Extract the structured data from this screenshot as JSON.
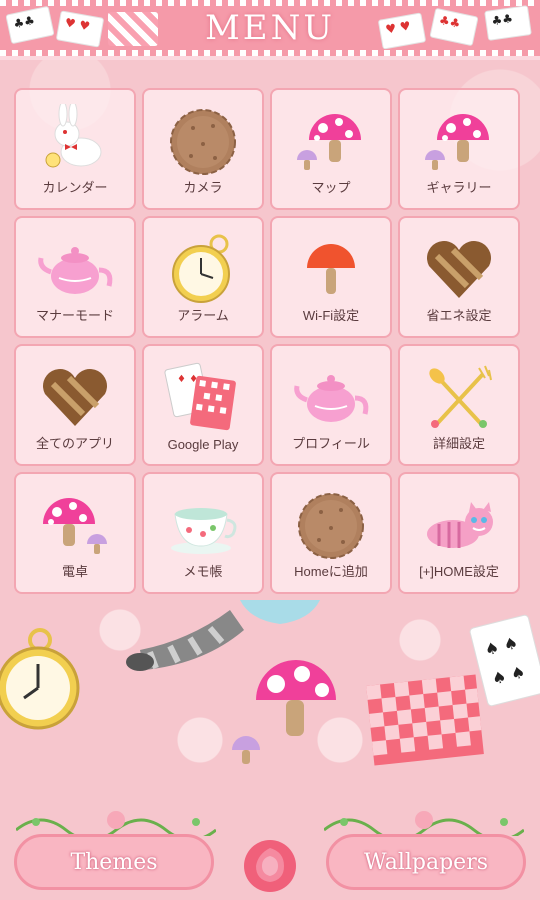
{
  "header": {
    "title": "MENU",
    "cards_left": [
      {
        "symbol": "♣♣",
        "suit": "black"
      },
      {
        "symbol": "♥ ♥",
        "suit": "red"
      }
    ],
    "cards_right": [
      {
        "symbol": "♥ ♥",
        "suit": "red"
      },
      {
        "symbol": "♣♣",
        "suit": "black"
      }
    ]
  },
  "apps": [
    {
      "label": "カレンダー",
      "icon": "white-rabbit-icon"
    },
    {
      "label": "カメラ",
      "icon": "cookie-icon"
    },
    {
      "label": "マップ",
      "icon": "mushroom-icon"
    },
    {
      "label": "ギャラリー",
      "icon": "mushroom-icon"
    },
    {
      "label": "マナーモード",
      "icon": "teapot-icon"
    },
    {
      "label": "アラーム",
      "icon": "pocket-watch-icon"
    },
    {
      "label": "Wi-Fi設定",
      "icon": "red-lollipop-icon"
    },
    {
      "label": "省エネ設定",
      "icon": "chocolate-heart-icon"
    },
    {
      "label": "全てのアプリ",
      "icon": "chocolate-heart-icon"
    },
    {
      "label": "Google Play",
      "icon": "playing-cards-icon"
    },
    {
      "label": "プロフィール",
      "icon": "teapot-icon"
    },
    {
      "label": "詳細設定",
      "icon": "spoon-fork-icon"
    },
    {
      "label": "電卓",
      "icon": "mushroom-icon"
    },
    {
      "label": "メモ帳",
      "icon": "teacup-icon"
    },
    {
      "label": "Homeに追加",
      "icon": "cookie-icon"
    },
    {
      "label": "[+]HOME設定",
      "icon": "cheshire-cat-icon"
    }
  ],
  "dock": {
    "themes_label": "Themes",
    "wallpapers_label": "Wallpapers",
    "center_icon": "rose-icon"
  },
  "colors": {
    "accent": "#f59aa9",
    "background": "#f6c6cd",
    "tile_border": "#f3a6b2",
    "label_text": "#5a3b3e"
  }
}
